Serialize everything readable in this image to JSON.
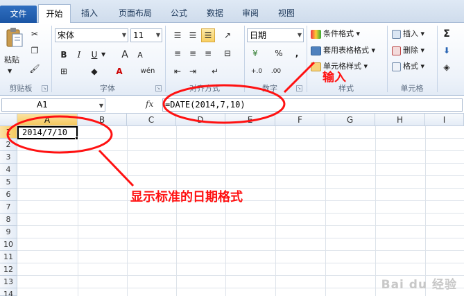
{
  "tabs": [
    "文件",
    "开始",
    "插入",
    "页面布局",
    "公式",
    "数据",
    "审阅",
    "视图"
  ],
  "clipboard": {
    "paste_label": "粘贴",
    "group_label": "剪贴板"
  },
  "font": {
    "name": "宋体",
    "size": "11",
    "bold": "B",
    "italic": "I",
    "underline": "U",
    "grow": "A",
    "shrink": "A",
    "group_label": "字体",
    "phonetic": "wén"
  },
  "alignment": {
    "group_label": "对齐方式"
  },
  "number": {
    "format": "日期",
    "percent": "%",
    "comma": ",",
    "group_label": "数字",
    "currency": "¥"
  },
  "styles": {
    "conditional": "条件格式",
    "table": "套用表格格式",
    "cell_styles": "单元格样式",
    "group_label": "样式"
  },
  "cells": {
    "insert": "插入",
    "delete": "删除",
    "format": "格式",
    "group_label": "单元格"
  },
  "editing": {
    "sum": "Σ"
  },
  "formula_bar": {
    "name_box": "A1",
    "fx": "fx",
    "formula": "=DATE(2014,7,10)"
  },
  "columns": [
    "A",
    "B",
    "C",
    "D",
    "E",
    "F",
    "G",
    "H",
    "I"
  ],
  "rows": [
    "1",
    "2",
    "3",
    "4",
    "5",
    "6",
    "7",
    "8",
    "9",
    "10",
    "11",
    "12",
    "13",
    "14"
  ],
  "cell_A1": "2014/7/10",
  "annotations": {
    "input": "输入",
    "display": "显示标准的日期格式"
  },
  "watermark": "Bai du 经验",
  "colors": {
    "annotation": "#ff1111",
    "file_tab": "#2a66b4",
    "selected_header": "#f5c85d"
  }
}
